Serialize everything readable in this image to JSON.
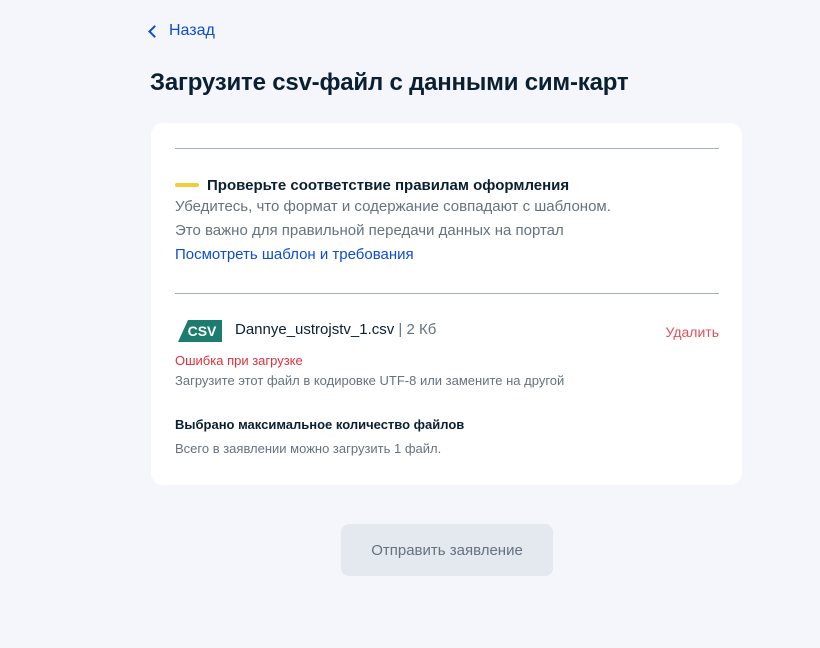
{
  "back": {
    "label": "Назад"
  },
  "page": {
    "title": "Загрузите csv-файл с данными сим-карт"
  },
  "notice": {
    "title": "Проверьте соответствие правилам оформления",
    "line1": "Убедитесь, что формат и содержание совпадают с шаблоном.",
    "line2": "Это важно для правильной передачи данных на портал",
    "link": "Посмотреть шаблон и требования",
    "accent_color": "#f2cd3a"
  },
  "file": {
    "badge": "CSV",
    "badge_color": "#1c7c6d",
    "name": "Dannye_ustrojstv_1.csv",
    "separator": "|",
    "size": "2 Кб",
    "delete_label": "Удалить",
    "error_title": "Ошибка при загрузке",
    "error_text": "Загрузите этот файл в кодировке UTF-8 или замените на другой"
  },
  "limit": {
    "title": "Выбрано максимальное количество файлов",
    "text": "Всего в заявлении можно загрузить 1  файл."
  },
  "submit": {
    "label": "Отправить заявление"
  },
  "colors": {
    "link": "#0d4cd3",
    "error": "#e0313c",
    "background": "#f4f6fb"
  }
}
